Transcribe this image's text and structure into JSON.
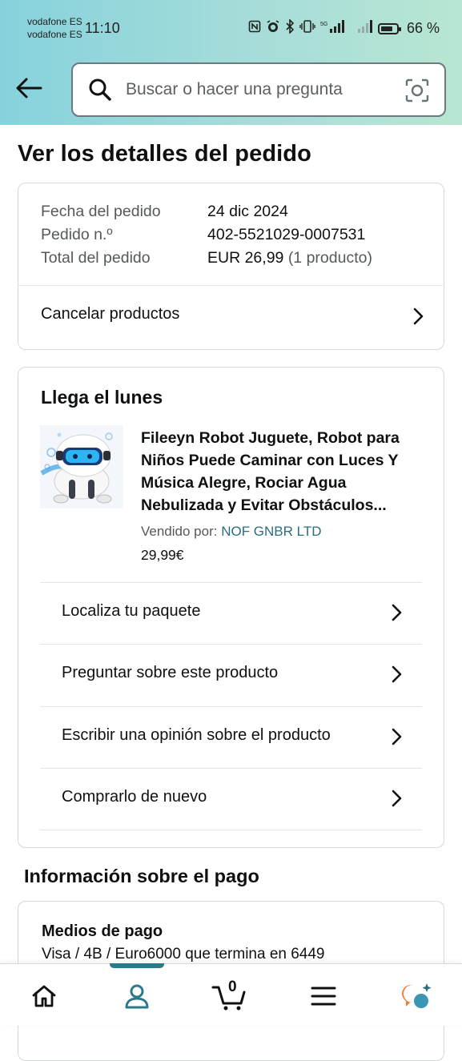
{
  "status_bar": {
    "carrier_1": "vodafone ES",
    "carrier_2": "vodafone ES",
    "time": "11:10",
    "battery": "66 %"
  },
  "header": {
    "search_placeholder": "Buscar o hacer una pregunta"
  },
  "page": {
    "title": "Ver los detalles del pedido"
  },
  "order_summary": {
    "date_label": "Fecha del pedido",
    "date_value": "24 dic 2024",
    "number_label": "Pedido n.º",
    "number_value": "402-5521029-0007531",
    "total_label": "Total del pedido",
    "total_value": "EUR 26,99",
    "total_count": "(1 producto)",
    "cancel_label": "Cancelar productos"
  },
  "shipment": {
    "heading": "Llega el lunes",
    "product_title": "Fileeyn Robot Juguete, Robot para Niños Puede Caminar con Luces Y Música Alegre, Rociar Agua Nebulizada y Evitar Obstáculos...",
    "seller_label": "Vendido por:",
    "seller_name": "NOF GNBR LTD",
    "price": "29,99€",
    "actions": [
      "Localiza tu paquete",
      "Preguntar sobre este producto",
      "Escribir una opinión sobre el producto",
      "Comprarlo de nuevo"
    ]
  },
  "payment": {
    "section_title": "Información sobre el pago",
    "methods_label": "Medios de pago",
    "methods_value": "Visa / 4B / Euro6000  que termina en 6449"
  },
  "bottom_nav": {
    "cart_count": "0",
    "active_tab": "account",
    "accent_color": "#2a7a8a"
  },
  "icons": [
    "back-arrow-icon",
    "search-icon",
    "camera-icon",
    "chevron-right-icon",
    "home-icon",
    "account-icon",
    "cart-icon",
    "menu-icon",
    "rufus-ai-icon"
  ]
}
